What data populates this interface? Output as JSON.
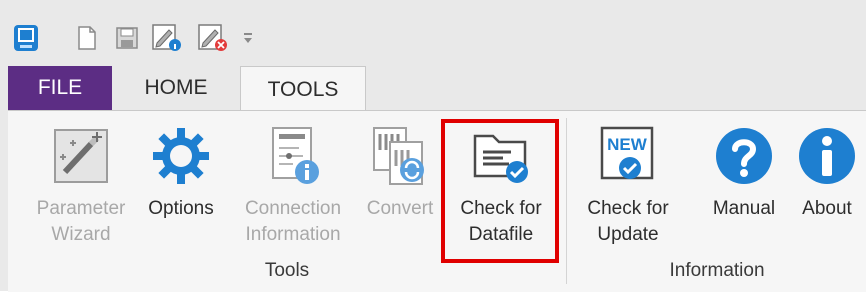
{
  "tabs": {
    "file": "FILE",
    "home": "HOME",
    "tools": "TOOLS"
  },
  "ribbon": {
    "parameter_wizard": {
      "line1": "Parameter",
      "line2": "Wizard",
      "state": "disabled"
    },
    "options": {
      "line1": "Options",
      "line2": "",
      "state": "enabled"
    },
    "connection_information": {
      "line1": "Connection",
      "line2": "Information",
      "state": "disabled"
    },
    "convert": {
      "line1": "Convert",
      "line2": "",
      "state": "disabled"
    },
    "check_for_datafile": {
      "line1": "Check for",
      "line2": "Datafile",
      "state": "enabled",
      "highlighted": true
    },
    "check_for_update": {
      "line1": "Check for",
      "line2": "Update",
      "state": "enabled",
      "badge": "NEW"
    },
    "manual": {
      "line1": "Manual",
      "line2": "",
      "state": "enabled"
    },
    "about": {
      "line1": "About",
      "line2": "",
      "state": "enabled"
    },
    "groups": {
      "tools": "Tools",
      "information": "Information"
    }
  },
  "colors": {
    "file_tab": "#5c2d84",
    "accent_blue": "#1e7fd0",
    "highlight_red": "#e00000"
  }
}
